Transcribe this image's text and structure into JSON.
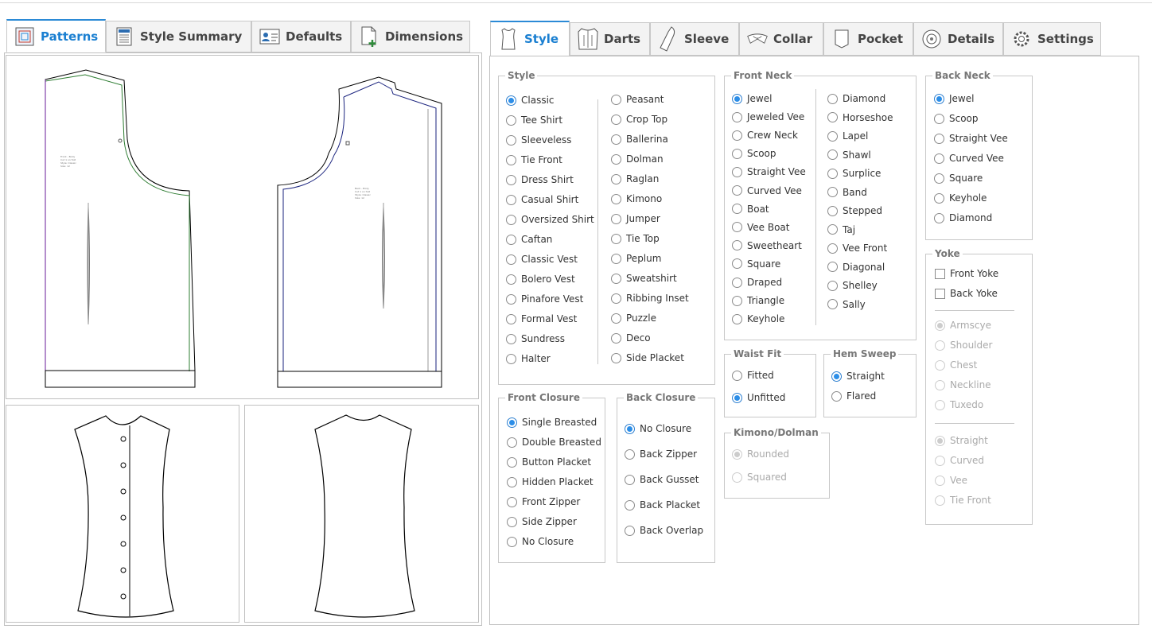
{
  "left_tabs": [
    {
      "label": "Patterns",
      "icon": "patterns-icon",
      "active": true
    },
    {
      "label": "Style Summary",
      "icon": "style-summary-icon",
      "active": false
    },
    {
      "label": "Defaults",
      "icon": "defaults-icon",
      "active": false
    },
    {
      "label": "Dimensions",
      "icon": "dimensions-icon",
      "active": false
    }
  ],
  "right_tabs": [
    {
      "label": "Style",
      "icon": "tank-top-icon",
      "active": true
    },
    {
      "label": "Darts",
      "icon": "darts-icon",
      "active": false
    },
    {
      "label": "Sleeve",
      "icon": "sleeve-icon",
      "active": false
    },
    {
      "label": "Collar",
      "icon": "collar-icon",
      "active": false
    },
    {
      "label": "Pocket",
      "icon": "pocket-icon",
      "active": false
    },
    {
      "label": "Details",
      "icon": "details-icon",
      "active": false
    },
    {
      "label": "Settings",
      "icon": "gear-icon",
      "active": false
    }
  ],
  "style_group": {
    "title": "Style",
    "col1": [
      "Classic",
      "Tee Shirt",
      "Sleeveless",
      "Tie Front",
      "Dress Shirt",
      "Casual Shirt",
      "Oversized Shirt",
      "Caftan",
      "Classic Vest",
      "Bolero Vest",
      "Pinafore Vest",
      "Formal Vest",
      "Sundress",
      "Halter"
    ],
    "col2": [
      "Peasant",
      "Crop Top",
      "Ballerina",
      "Dolman",
      "Raglan",
      "Kimono",
      "Jumper",
      "Tie Top",
      "Peplum",
      "Sweatshirt",
      "Ribbing Inset",
      "Puzzle",
      "Deco",
      "Side Placket"
    ],
    "selected": "Classic"
  },
  "front_neck": {
    "title": "Front Neck",
    "col1": [
      "Jewel",
      "Jeweled Vee",
      "Crew Neck",
      "Scoop",
      "Straight Vee",
      "Curved Vee",
      "Boat",
      "Vee Boat",
      "Sweetheart",
      "Square",
      "Draped",
      "Triangle",
      "Keyhole"
    ],
    "col2": [
      "Diamond",
      "Horseshoe",
      "Lapel",
      "Shawl",
      "Surplice",
      "Band",
      "Stepped",
      "Taj",
      "Vee Front",
      "Diagonal",
      "Shelley",
      "Sally"
    ],
    "selected": "Jewel"
  },
  "back_neck": {
    "title": "Back Neck",
    "items": [
      "Jewel",
      "Scoop",
      "Straight Vee",
      "Curved Vee",
      "Square",
      "Keyhole",
      "Diamond"
    ],
    "selected": "Jewel"
  },
  "front_closure": {
    "title": "Front Closure",
    "items": [
      "Single Breasted",
      "Double Breasted",
      "Button Placket",
      "Hidden Placket",
      "Front Zipper",
      "Side Zipper",
      "No Closure"
    ],
    "selected": "Single Breasted"
  },
  "back_closure": {
    "title": "Back Closure",
    "items": [
      "No Closure",
      "Back Zipper",
      "Back Gusset",
      "Back Placket",
      "Back Overlap"
    ],
    "selected": "No Closure"
  },
  "waist_fit": {
    "title": "Waist Fit",
    "items": [
      "Fitted",
      "Unfitted"
    ],
    "selected": "Unfitted"
  },
  "hem_sweep": {
    "title": "Hem Sweep",
    "items": [
      "Straight",
      "Flared"
    ],
    "selected": "Straight"
  },
  "kimono_dolman": {
    "title": "Kimono/Dolman",
    "items": [
      "Rounded",
      "Squared"
    ],
    "selected": "Rounded"
  },
  "yoke": {
    "title": "Yoke",
    "checks": [
      "Front Yoke",
      "Back Yoke"
    ],
    "group1": [
      "Armscye",
      "Shoulder",
      "Chest",
      "Neckline",
      "Tuxedo"
    ],
    "group1_selected": "Armscye",
    "group2": [
      "Straight",
      "Curved",
      "Vee",
      "Tie Front"
    ],
    "group2_selected": "Straight"
  },
  "colors": {
    "accent": "#2b8ad6",
    "front_piece": "#2e7d32",
    "back_piece": "#1a237e",
    "grainline": "#6a1b9a"
  }
}
